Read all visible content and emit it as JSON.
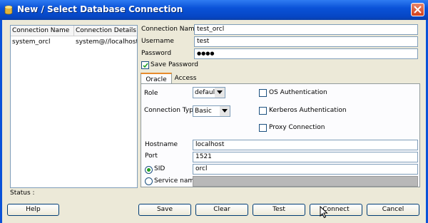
{
  "window": {
    "title": "New / Select Database Connection"
  },
  "connections": {
    "headers": [
      "Connection Name",
      "Connection Details"
    ],
    "rows": [
      {
        "name": "system_orcl",
        "details": "system@//localhost..."
      }
    ]
  },
  "form": {
    "connection_name": {
      "label": "Connection Name",
      "value": "test_orcl"
    },
    "username": {
      "label": "Username",
      "value": "test"
    },
    "password": {
      "label": "Password",
      "value": "●●●●"
    },
    "save_password": {
      "label": "Save Password",
      "checked": true
    }
  },
  "tabs": [
    "Oracle",
    "Access"
  ],
  "oracle": {
    "role": {
      "label": "Role",
      "value": "default"
    },
    "connection_type": {
      "label": "Connection Type",
      "value": "Basic"
    },
    "os_auth": {
      "label": "OS Authentication",
      "checked": false
    },
    "kerberos_auth": {
      "label": "Kerberos Authentication",
      "checked": false
    },
    "proxy": {
      "label": "Proxy Connection",
      "checked": false
    },
    "hostname": {
      "label": "Hostname",
      "value": "localhost"
    },
    "port": {
      "label": "Port",
      "value": "1521"
    },
    "sid": {
      "label": "SID",
      "value": "orcl",
      "selected": true
    },
    "service_name": {
      "label": "Service name",
      "value": "",
      "selected": false
    }
  },
  "status": {
    "label": "Status :"
  },
  "buttons": {
    "help": "Help",
    "save": "Save",
    "clear": "Clear",
    "test": "Test",
    "connect": "Connect",
    "cancel": "Cancel"
  },
  "colors": {
    "title_bar": "#0a52d8",
    "close": "#d3401b",
    "dialog_bg": "#ece9d8",
    "tab_accent": "#e68b2c"
  }
}
